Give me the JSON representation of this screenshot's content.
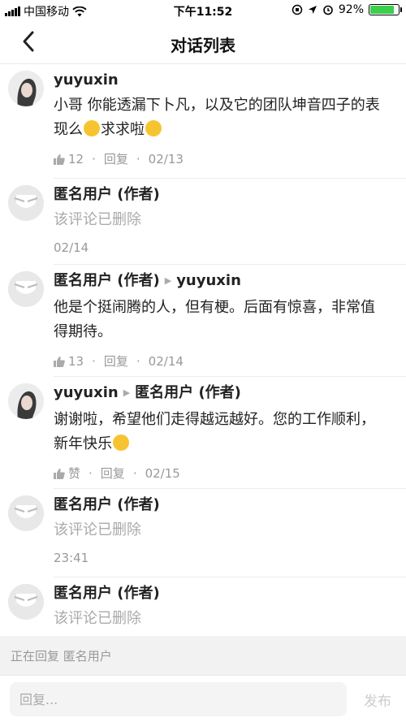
{
  "status_bar": {
    "carrier": "中国移动",
    "time": "下午11:52",
    "battery_percent": "92%",
    "battery_level": 0.92,
    "battery_color": "#3ccf4e"
  },
  "nav": {
    "title": "对话列表",
    "back_icon": "chevron-left-icon"
  },
  "comments": [
    {
      "author": "yuyuxin",
      "reply_to": "",
      "avatar": "user-photo",
      "text": "小哥 你能透漏下卜凡，以及它的团队坤音四子的表现么",
      "text_suffix": "求求啦",
      "emojis": [
        "flushed-face-emoji",
        "relieved-face-emoji"
      ],
      "likes": "12",
      "reply_label": "回复",
      "date": "02/13",
      "deleted": false
    },
    {
      "author": "匿名用户 (作者)",
      "reply_to": "",
      "avatar": "anonymous",
      "text": "该评论已删除",
      "date": "02/14",
      "deleted": true
    },
    {
      "author": "匿名用户 (作者)",
      "reply_to": "yuyuxin",
      "avatar": "anonymous",
      "text": "他是个挺闹腾的人，但有梗。后面有惊喜，非常值得期待。",
      "likes": "13",
      "reply_label": "回复",
      "date": "02/14",
      "deleted": false
    },
    {
      "author": "yuyuxin",
      "reply_to": "匿名用户 (作者)",
      "avatar": "user-photo",
      "text": "谢谢啦，希望他们走得越远越好。您的工作顺利，新年快乐",
      "emojis": [
        "grinning-face-emoji"
      ],
      "likes": "赞",
      "reply_label": "回复",
      "date": "02/15",
      "deleted": false
    },
    {
      "author": "匿名用户 (作者)",
      "reply_to": "",
      "avatar": "anonymous",
      "text": "该评论已删除",
      "date": "23:41",
      "deleted": true
    },
    {
      "author": "匿名用户 (作者)",
      "reply_to": "",
      "avatar": "anonymous",
      "text": "该评论已删除",
      "deleted": true
    }
  ],
  "replying": {
    "label": "正在回复 匿名用户"
  },
  "composer": {
    "placeholder": "回复...",
    "send_label": "发布"
  }
}
